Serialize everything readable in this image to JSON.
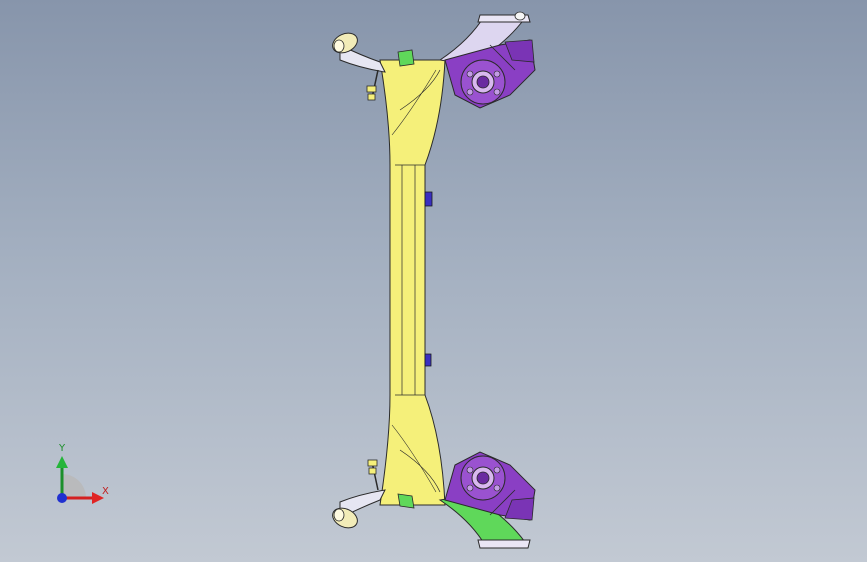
{
  "viewport": {
    "background_top": "#8795ab",
    "background_bottom": "#c2c9d3"
  },
  "model": {
    "description_icon": "rear-axle-torsion-beam-model",
    "colors": {
      "beam": "#f5f07a",
      "arm": "#e6e6f2",
      "knuckle": "#8a3fc4",
      "bracket": "#3a2fc0",
      "green_part": "#5fd85a",
      "bushing": "#f2ecb8"
    }
  },
  "triad": {
    "y_label": "Y",
    "x_label": "X",
    "y_color": "#1c8f2a",
    "x_color": "#d42020",
    "z_color": "#2030d0"
  }
}
